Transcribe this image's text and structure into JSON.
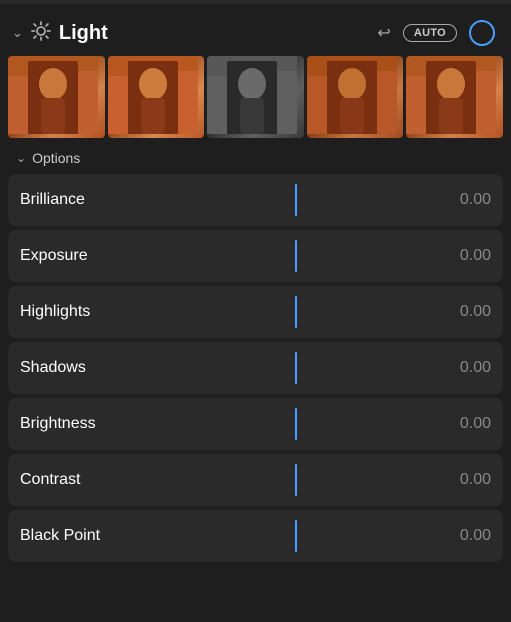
{
  "header": {
    "title": "Light",
    "auto_label": "AUTO",
    "chevron_symbol": "⌄",
    "sun_symbol": "☀",
    "undo_symbol": "↩"
  },
  "options": {
    "label": "Options",
    "chevron_symbol": "⌄"
  },
  "sliders": [
    {
      "id": "brilliance",
      "label": "Brilliance",
      "value": "0.00"
    },
    {
      "id": "exposure",
      "label": "Exposure",
      "value": "0.00"
    },
    {
      "id": "highlights",
      "label": "Highlights",
      "value": "0.00"
    },
    {
      "id": "shadows",
      "label": "Shadows",
      "value": "0.00"
    },
    {
      "id": "brightness",
      "label": "Brightness",
      "value": "0.00"
    },
    {
      "id": "contrast",
      "label": "Contrast",
      "value": "0.00"
    },
    {
      "id": "black-point",
      "label": "Black Point",
      "value": "0.00"
    }
  ],
  "preview_frames": [
    {
      "id": "frame-1",
      "class": "frame-1"
    },
    {
      "id": "frame-2",
      "class": "frame-2"
    },
    {
      "id": "frame-3",
      "class": "frame-3"
    },
    {
      "id": "frame-4",
      "class": "frame-4"
    },
    {
      "id": "frame-5",
      "class": "frame-5"
    }
  ],
  "colors": {
    "accent": "#4a9eff",
    "background": "#1e1e1e",
    "row_bg": "#2a2a2a",
    "label_color": "#ffffff",
    "value_color": "#888888"
  }
}
